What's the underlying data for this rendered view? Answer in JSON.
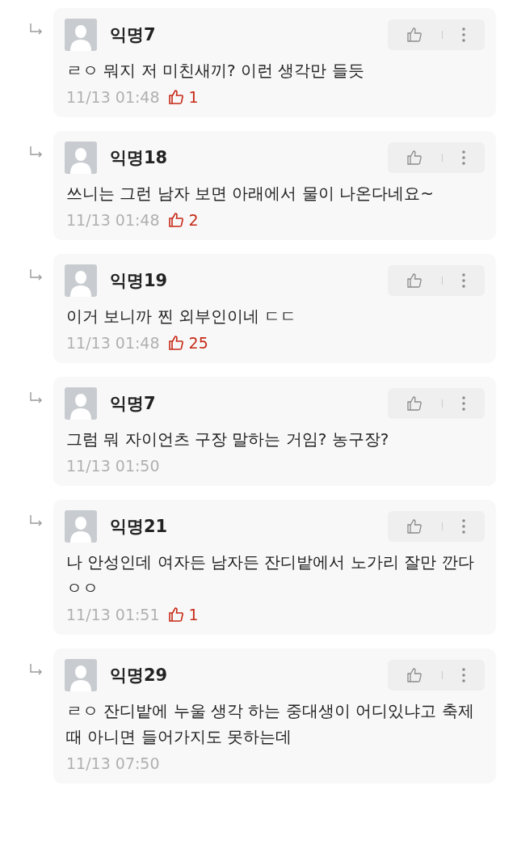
{
  "comments": [
    {
      "author": "익명7",
      "text": "ㄹㅇ 뭐지 저 미친새끼? 이런 생각만 들듯",
      "time": "11/13 01:48",
      "likes": "1"
    },
    {
      "author": "익명18",
      "text": "쓰니는 그런 남자 보면 아래에서 물이 나온다네요~",
      "time": "11/13 01:48",
      "likes": "2"
    },
    {
      "author": "익명19",
      "text": "이거 보니까 찐 외부인이네 ㄷㄷ",
      "time": "11/13 01:48",
      "likes": "25"
    },
    {
      "author": "익명7",
      "text": "그럼 뭐 자이언츠 구장 말하는 거임? 농구장?",
      "time": "11/13 01:50"
    },
    {
      "author": "익명21",
      "text": "나 안성인데 여자든 남자든 잔디밭에서 노가리 잘만 깐다 ㅇㅇ",
      "time": "11/13 01:51",
      "likes": "1"
    },
    {
      "author": "익명29",
      "text": "ㄹㅇ 잔디밭에 누울 생각 하는 중대생이 어디있냐고 축제 때 아니면 들어가지도 못하는데",
      "time": "11/13 07:50"
    }
  ]
}
